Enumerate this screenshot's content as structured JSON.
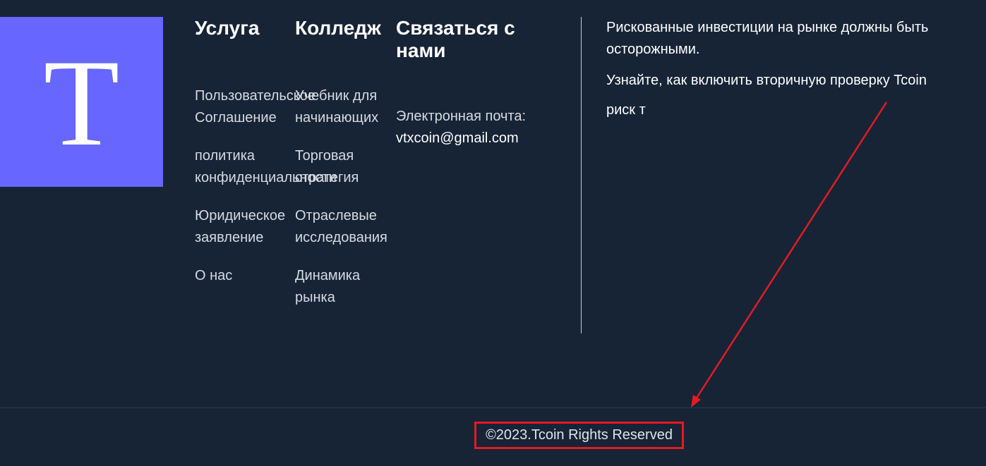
{
  "logo": {
    "letter": "T",
    "color": "#6767ff"
  },
  "columns": {
    "service": {
      "title": "Услуга",
      "links": [
        "Пользовательское Соглашение",
        "политика конфиденциальности",
        "Юридическое заявление",
        "О нас"
      ]
    },
    "college": {
      "title": "Колледж",
      "links": [
        "Учебник для начинающих",
        "Торговая стратегия",
        "Отраслевые исследования",
        "Динамика рынка"
      ]
    },
    "contact": {
      "title": "Связаться с нами",
      "email_label": "Электронная почта:",
      "email": "vtxcoin@gmail.com"
    }
  },
  "notice": {
    "line1": "Рискованные инвестиции на рынке должны быть осторожными.",
    "line2": "Узнайте, как включить вторичную проверку Tcoin",
    "line3": "риск т"
  },
  "footer": {
    "copyright": "©2023.Tcoin Rights Reserved"
  },
  "annotation": {
    "color": "#e31b23",
    "icon": "red-arrow-icon"
  }
}
